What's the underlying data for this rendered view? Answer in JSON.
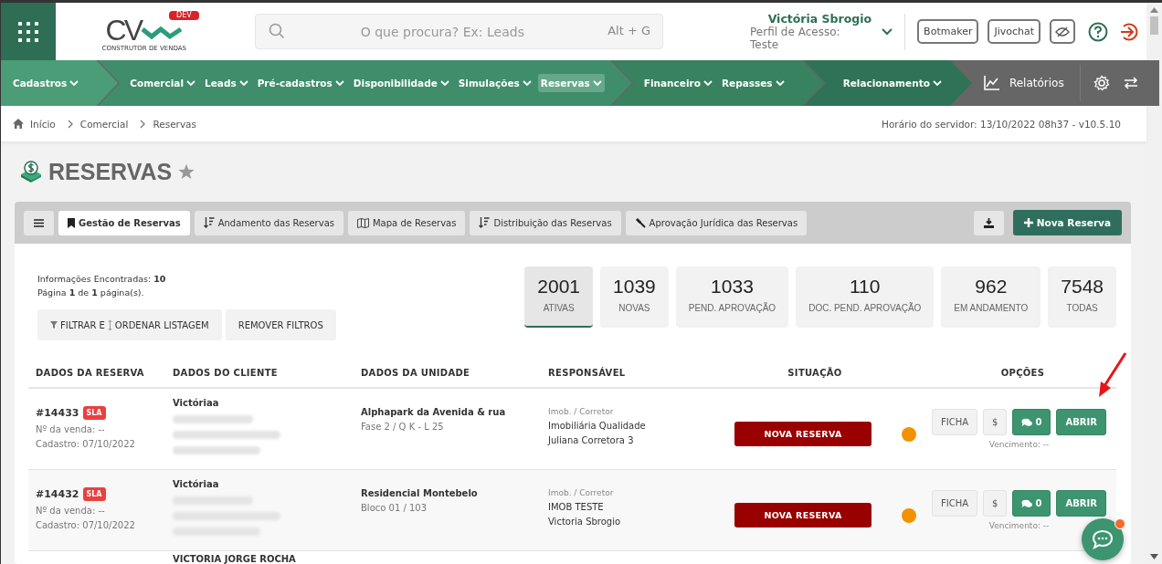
{
  "logo": {
    "mark": "CV",
    "badge": "DEV",
    "tagline": "CONSTRUTOR DE VENDAS"
  },
  "search": {
    "placeholder": "O que procura? Ex: Leads",
    "shortcut": "Alt + G"
  },
  "user": {
    "name": "Victória Sbrogio",
    "profile": "Perfil de Acesso: Teste"
  },
  "header_buttons": [
    "Botmaker",
    "Jivochat"
  ],
  "nav": {
    "segments": [
      {
        "items": [
          {
            "label": "Cadastros",
            "selected": false
          }
        ]
      },
      {
        "items": [
          {
            "label": "Comercial",
            "selected": false
          },
          {
            "label": "Leads",
            "selected": false
          },
          {
            "label": "Pré-cadastros",
            "selected": false
          },
          {
            "label": "Disponibilidade",
            "selected": false
          },
          {
            "label": "Simulações",
            "selected": false
          },
          {
            "label": "Reservas",
            "selected": true
          }
        ]
      },
      {
        "items": [
          {
            "label": "Financeiro",
            "selected": false
          },
          {
            "label": "Repasses",
            "selected": false
          }
        ]
      },
      {
        "items": [
          {
            "label": "Relacionamento",
            "selected": false
          }
        ]
      }
    ],
    "reports": "Relatórios"
  },
  "breadcrumb": [
    "Início",
    "Comercial",
    "Reservas"
  ],
  "server_time": "Horário do servidor: 13/10/2022 08h37 - v10.5.10",
  "page_title": "RESERVAS",
  "tabs": [
    {
      "label": "Gestão de Reservas",
      "selected": true
    },
    {
      "label": "Andamento das Reservas",
      "selected": false
    },
    {
      "label": "Mapa de Reservas",
      "selected": false
    },
    {
      "label": "Distribuição das Reservas",
      "selected": false
    },
    {
      "label": "Aprovação Jurídica das Reservas",
      "selected": false
    }
  ],
  "new_button": "Nova Reserva",
  "info": {
    "found": "Informações Encontradas: **10**",
    "page": "Página **1** de **1** página(s)."
  },
  "filter_buttons": [
    "FILTRAR E",
    "ORDENAR LISTAGEM",
    "REMOVER FILTROS"
  ],
  "stats": [
    {
      "value": "2001",
      "label": "ATIVAS",
      "selected": true
    },
    {
      "value": "1039",
      "label": "NOVAS",
      "selected": false
    },
    {
      "value": "1033",
      "label": "PEND. APROVAÇÃO",
      "selected": false
    },
    {
      "value": "110",
      "label": "DOC. PEND. APROVAÇÃO",
      "selected": false
    },
    {
      "value": "962",
      "label": "EM ANDAMENTO",
      "selected": false
    },
    {
      "value": "7548",
      "label": "TODAS",
      "selected": false
    }
  ],
  "table": {
    "columns": [
      "DADOS DA RESERVA",
      "DADOS DO CLIENTE",
      "DADOS DA UNIDADE",
      "RESPONSÁVEL",
      "SITUAÇÃO",
      "OPÇÕES"
    ],
    "rows": [
      {
        "id": "#14433",
        "badge": "SLA",
        "sale": "Nº da venda: --",
        "date": "Cadastro: 07/10/2022",
        "client": "Victóriaa",
        "unit": "Alphapark da Avenida & rua",
        "unit_detail": "Fase 2 / Q K - L 25",
        "role": "Imob. / Corretor",
        "agency": "Imobiliária Qualidade",
        "broker": "Juliana Corretora 3",
        "status": "NOVA RESERVA",
        "buttons": [
          "FICHA",
          "$",
          "0",
          "ABRIR"
        ],
        "due": "Vencimento: --"
      },
      {
        "id": "#14432",
        "badge": "SLA",
        "sale": "Nº da venda: --",
        "date": "Cadastro: 07/10/2022",
        "client": "Victóriaa",
        "unit": "Residencial Montebelo",
        "unit_detail": "Bloco 01 / 103",
        "role": "Imob. / Corretor",
        "agency": "IMOB TESTE",
        "broker": "Victoria Sbrogio",
        "status": "NOVA RESERVA",
        "buttons": [
          "FICHA",
          "$",
          "0",
          "ABRIR"
        ],
        "due": "Vencimento: --"
      },
      {
        "client": "VICTORIA JORGE ROCHA"
      }
    ]
  }
}
